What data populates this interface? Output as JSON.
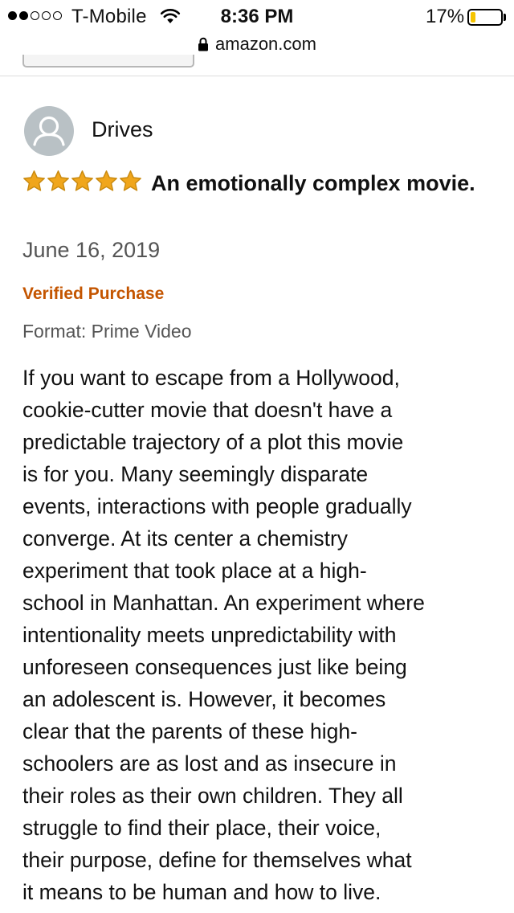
{
  "status_bar": {
    "signal_filled": 2,
    "signal_total": 5,
    "carrier": "T-Mobile",
    "time": "8:36 PM",
    "battery_percent": "17%",
    "battery_level": 0.17,
    "battery_color": "#f5c400"
  },
  "browser": {
    "url": "amazon.com"
  },
  "review": {
    "reviewer_name": "Drives",
    "rating": 5,
    "title": "An emotionally complex movie.",
    "date": "June 16, 2019",
    "verified_label": "Verified Purchase",
    "format": "Format: Prime Video",
    "body_lines": [
      "If you want to escape from a Hollywood,",
      "cookie-cutter movie that doesn't have a",
      "predictable trajectory of a plot this movie",
      "is for you. Many seemingly disparate",
      "events, interactions with people gradually",
      "converge. At its center a chemistry",
      "experiment that took place at a high-",
      "school in Manhattan. An experiment where",
      "intentionality meets unpredictability with",
      "unforeseen consequences just like being",
      "an adolescent is. However, it becomes",
      "clear that the parents of these high-",
      "schoolers are as lost and as insecure in",
      "their roles as their own children. They all",
      "struggle to find their place, their voice,",
      "their purpose, define for themselves what",
      "it means to be human and how to live."
    ]
  },
  "colors": {
    "star": "#f0a61c",
    "star_outline": "#c98a10",
    "verified": "#c45500",
    "muted_text": "#555555"
  }
}
